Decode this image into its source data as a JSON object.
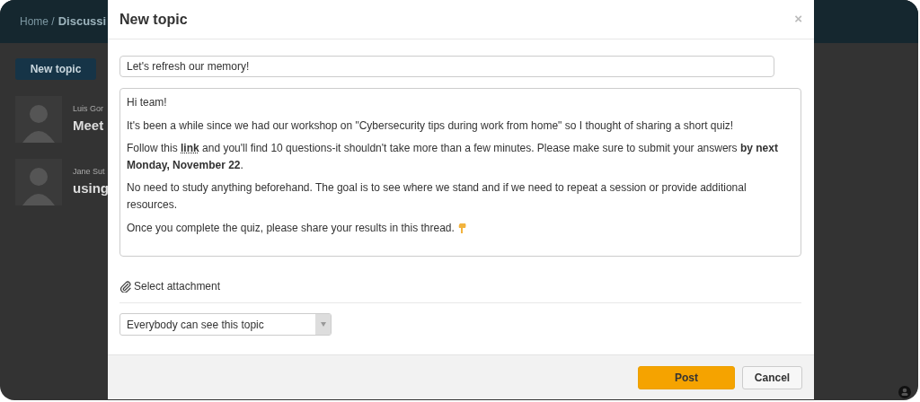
{
  "background": {
    "breadcrumb": {
      "home": "Home /",
      "current": "Discussi"
    },
    "new_topic_button": "New topic",
    "posts": [
      {
        "author": "Luis Gor",
        "title": "Meet"
      },
      {
        "author": "Jane Sut",
        "title": "using"
      }
    ]
  },
  "modal": {
    "title": "New topic",
    "close": "×",
    "subject": "Let's refresh our memory!",
    "body": [
      [
        {
          "kind": "text",
          "text": "Hi team!"
        }
      ],
      [
        {
          "kind": "text",
          "text": "It's been a while since we had our workshop on \"Cybersecurity tips during work from home\" so I thought of sharing a short quiz!"
        }
      ],
      [
        {
          "kind": "text",
          "text": "Follow this "
        },
        {
          "kind": "link",
          "text": "link"
        },
        {
          "kind": "text",
          "text": " and you'll find 10 questions-it shouldn't take more than a few minutes. Please make sure to submit your answers **by next Monday, November 22**."
        }
      ],
      [
        {
          "kind": "text",
          "text": "No need to study anything beforehand. The goal is to see where we stand and if we need to repeat a session or provide additional resources."
        }
      ],
      [
        {
          "kind": "text",
          "text": "Once you complete the quiz, please share your results in this thread. "
        },
        {
          "kind": "emoji"
        }
      ]
    ],
    "attachment": "Select attachment",
    "visibility": "Everybody can see this topic",
    "buttons": [
      {
        "label": "Post",
        "kind": "primary"
      },
      {
        "label": "Cancel",
        "kind": "secondary"
      }
    ]
  }
}
